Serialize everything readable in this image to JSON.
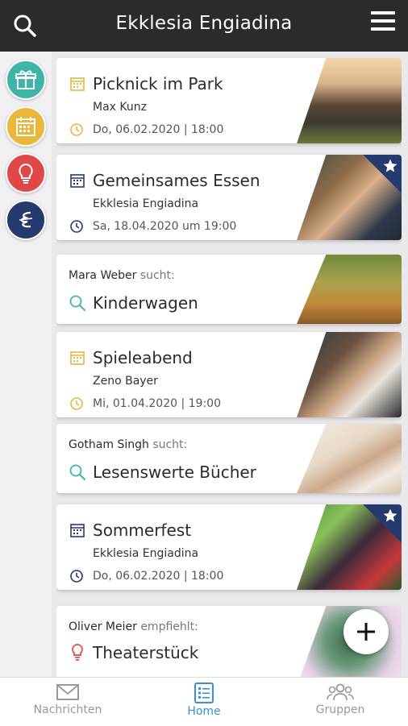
{
  "header": {
    "title": "Ekklesia Engiadina"
  },
  "sidebar": {
    "items": [
      "gift-icon",
      "calendar-icon",
      "lightbulb-icon",
      "ekklesia-logo-icon"
    ]
  },
  "cards": [
    {
      "type": "event",
      "title": "Picknick im Park",
      "subtitle": "Max Kunz",
      "date": "Do, 06.02.2020 | 18:00",
      "starred": false,
      "icon_color": "#e8b73c"
    },
    {
      "type": "event",
      "title": "Gemeinsames Essen",
      "subtitle": "Ekklesia Engiadina",
      "date": "Sa, 18.04.2020 um 19:00",
      "starred": true,
      "icon_color": "#253a6e"
    },
    {
      "type": "search",
      "name": "Mara Weber",
      "verb": "sucht:",
      "title": "Kinderwagen",
      "icon_color": "#3fb5a5"
    },
    {
      "type": "event",
      "title": "Spieleabend",
      "subtitle": "Zeno Bayer",
      "date": "Mi, 01.04.2020 | 19:00",
      "starred": false,
      "icon_color": "#e8b73c"
    },
    {
      "type": "search",
      "name": "Gotham Singh",
      "verb": "sucht:",
      "title": "Lesenswerte Bücher",
      "icon_color": "#3fb5a5"
    },
    {
      "type": "event",
      "title": "Sommerfest",
      "subtitle": "Ekklesia Engiadina",
      "date": "Do, 06.02.2020 | 18:00",
      "starred": true,
      "icon_color": "#253a6e"
    },
    {
      "type": "recommend",
      "name": "Oliver Meier",
      "verb": "empfiehlt:",
      "title": "Theaterstück",
      "icon_color": "#e04848"
    }
  ],
  "bottom_nav": [
    {
      "label": "Nachrichten",
      "icon": "envelope-icon",
      "active": false
    },
    {
      "label": "Home",
      "icon": "list-icon",
      "active": true
    },
    {
      "label": "Gruppen",
      "icon": "group-icon",
      "active": false
    }
  ],
  "colors": {
    "topbar": "#2b2a2d",
    "accent": "#3a8fd8",
    "navy": "#253a6e",
    "teal": "#3fb5a5",
    "yellow": "#e8b73c",
    "red": "#e04848"
  }
}
